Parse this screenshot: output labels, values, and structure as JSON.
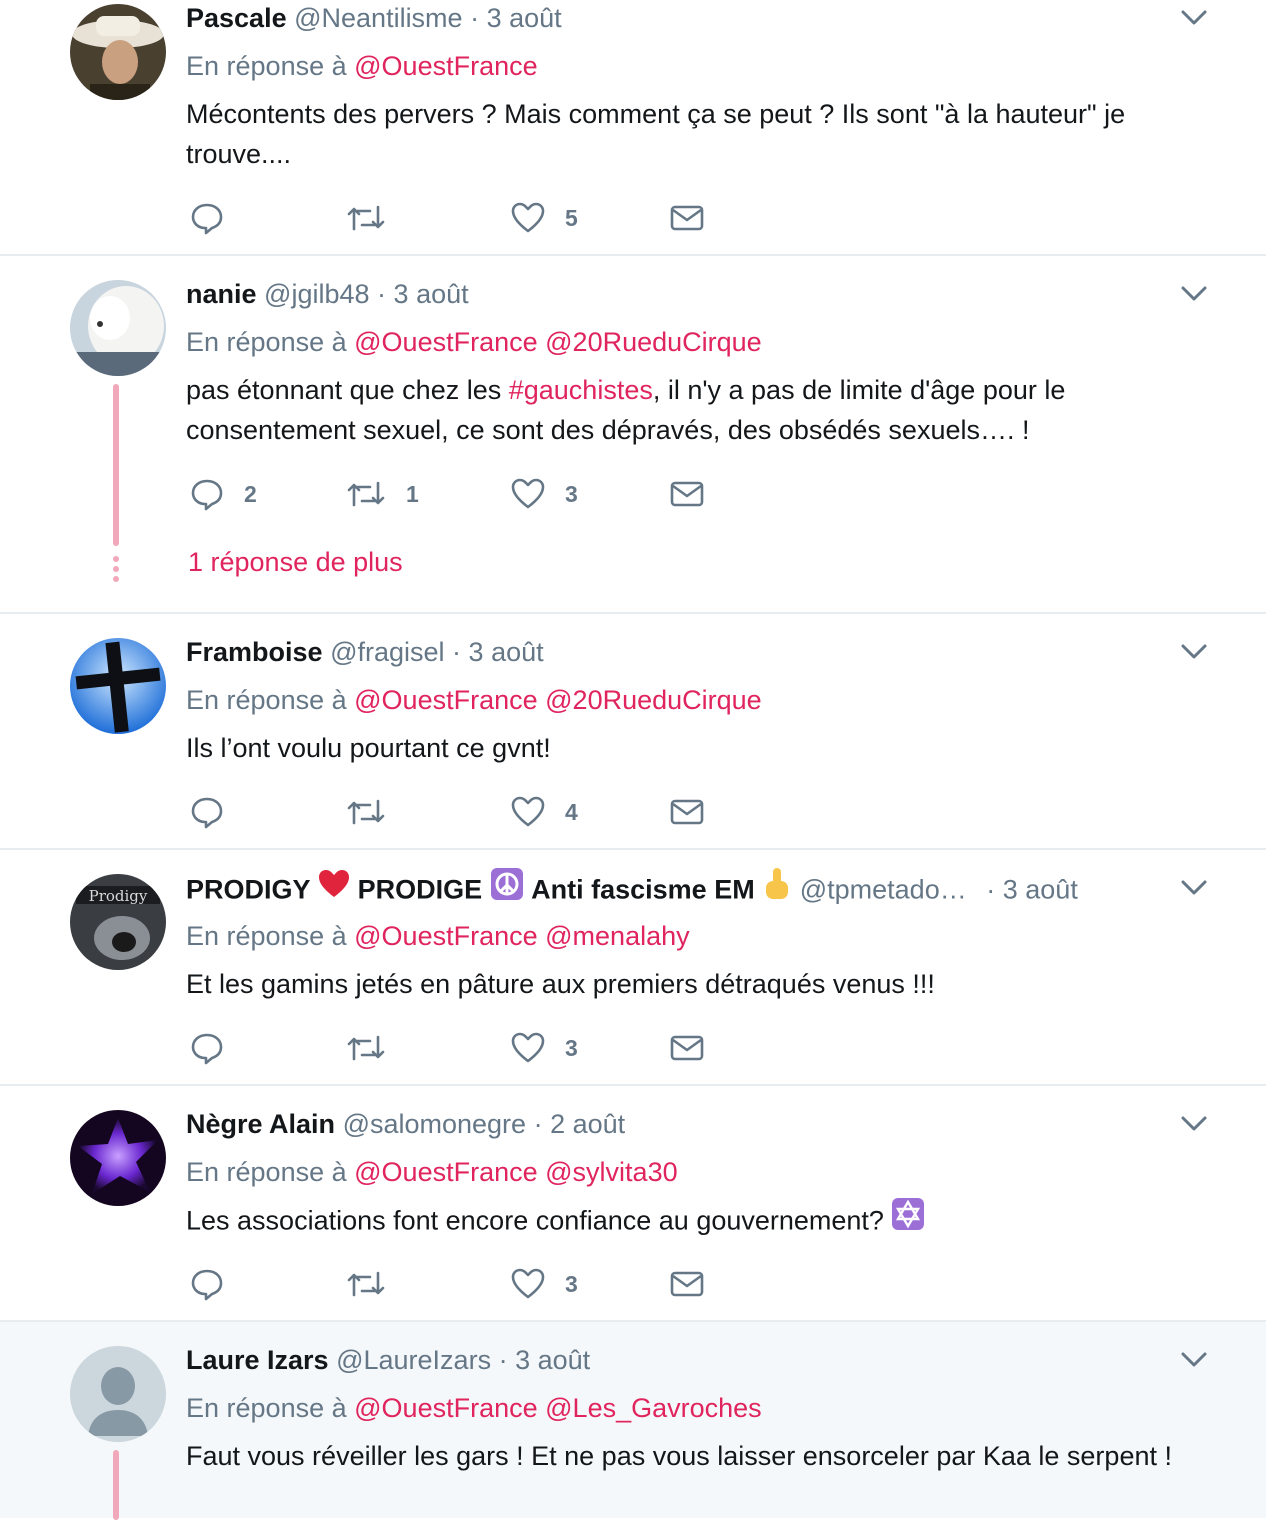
{
  "tweets": [
    {
      "name": "Pascale",
      "handle": "@Neantilisme",
      "date": "3 août",
      "reply_label": "En réponse à",
      "mentions": [
        "@OuestFrance"
      ],
      "text": "Mécontents des pervers ? Mais comment ça se peut ? Ils sont \"à la hauteur\" je trouve....",
      "counts": {
        "reply": "",
        "retweet": "",
        "like": "5"
      }
    },
    {
      "name": "nanie",
      "handle": "@jgilb48",
      "date": "3 août",
      "reply_label": "En réponse à",
      "mentions": [
        "@OuestFrance",
        "@20RueduCirque"
      ],
      "text_before": "pas étonnant que chez les ",
      "hashtag": "#gauchistes",
      "text_after": ", il n'y a pas de limite d'âge pour le consentement sexuel, ce sont des dépravés, des obsédés sexuels…. !",
      "counts": {
        "reply": "2",
        "retweet": "1",
        "like": "3"
      },
      "more_replies": "1 réponse de plus"
    },
    {
      "name": "Framboise",
      "handle": "@fragisel",
      "date": "3 août",
      "reply_label": "En réponse à",
      "mentions": [
        "@OuestFrance",
        "@20RueduCirque"
      ],
      "text": "Ils l’ont voulu pourtant ce gvnt!",
      "counts": {
        "reply": "",
        "retweet": "",
        "like": "4"
      }
    },
    {
      "name_part1": "PRODIGY",
      "name_part2": "PRODIGE",
      "name_part3": "Anti fascisme EM",
      "handle": "@tpmetado…",
      "date": "3 août",
      "reply_label": "En réponse à",
      "mentions": [
        "@OuestFrance",
        "@menalahy"
      ],
      "text": "Et les gamins jetés en pâture aux premiers détraqués venus !!!",
      "counts": {
        "reply": "",
        "retweet": "",
        "like": "3"
      }
    },
    {
      "name": "Nègre Alain",
      "handle": "@salomonegre",
      "date": "2 août",
      "reply_label": "En réponse à",
      "mentions": [
        "@OuestFrance",
        "@sylvita30"
      ],
      "text": "Les associations font encore confiance au gouvernement?",
      "counts": {
        "reply": "",
        "retweet": "",
        "like": "3"
      }
    },
    {
      "name": "Laure Izars",
      "handle": "@LaureIzars",
      "date": "3 août",
      "reply_label": "En réponse à",
      "mentions": [
        "@OuestFrance",
        "@Les_Gavroches"
      ],
      "text": "Faut vous réveiller les gars ! Et ne pas vous laisser ensorceler par Kaa le serpent !",
      "counts": {
        "reply": "",
        "retweet": "",
        "like": ""
      }
    }
  ],
  "separator": "·",
  "colors": {
    "accent": "#e0245e",
    "muted": "#657786",
    "thread": "#f0a8ba",
    "highlight_bg": "#f5f8fa"
  },
  "icons": [
    "reply-icon",
    "retweet-icon",
    "like-icon",
    "direct-message-icon",
    "caret-down-icon",
    "heart-emoji",
    "peace-symbol-emoji",
    "middle-finger-emoji",
    "star-of-david-emoji"
  ]
}
